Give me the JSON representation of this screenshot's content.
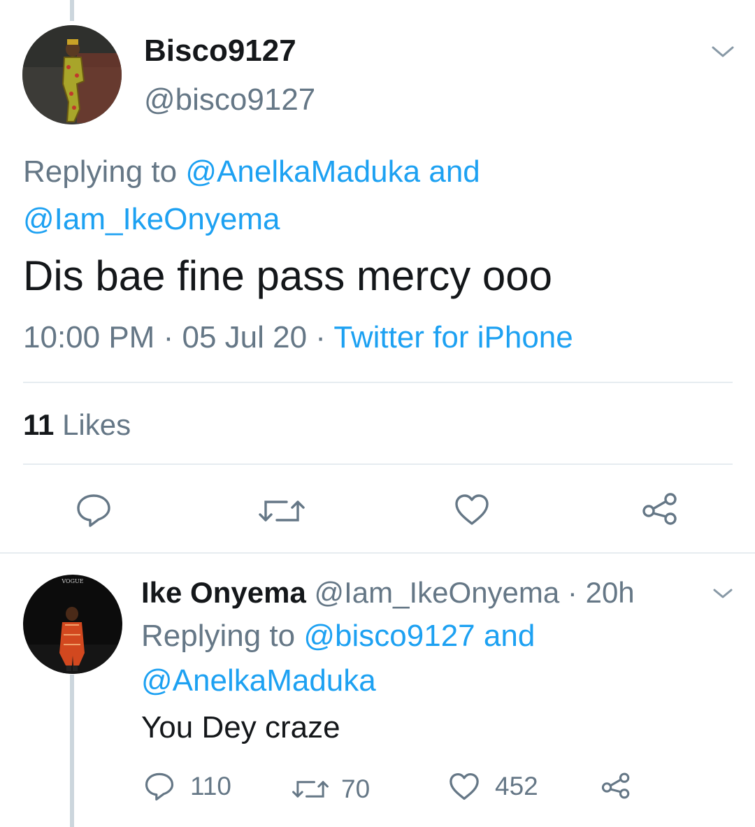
{
  "main_tweet": {
    "display_name": "Bisco9127",
    "handle": "@bisco9127",
    "replying_prefix": "Replying to",
    "replying_to_1": "@AnelkaMaduka",
    "replying_and": "and",
    "replying_to_2": "@Iam_IkeOnyema",
    "text": "Dis bae fine pass mercy ooo",
    "time": "10:00 PM",
    "sep1": "·",
    "date": "05 Jul 20",
    "sep2": "·",
    "source": "Twitter for iPhone",
    "likes_count": "11",
    "likes_label": "Likes",
    "actions": [
      "reply-icon",
      "retweet-icon",
      "like-icon",
      "share-icon"
    ]
  },
  "reply_tweet": {
    "display_name": "Ike Onyema",
    "handle": "@Iam_IkeOnyema",
    "sep": "·",
    "age": "20h",
    "replying_prefix": "Replying to",
    "replying_to_1": "@bisco9127",
    "replying_and": "and",
    "replying_to_2": "@AnelkaMaduka",
    "text": "You Dey craze",
    "reply_count": "110",
    "retweet_count": "70",
    "like_count": "452",
    "avatar_caption": "VOGUE"
  },
  "colors": {
    "link": "#1da1f2",
    "muted": "#657786",
    "text": "#14171a",
    "divider": "#e6ecf0",
    "thread_line": "#ccd6dd"
  }
}
